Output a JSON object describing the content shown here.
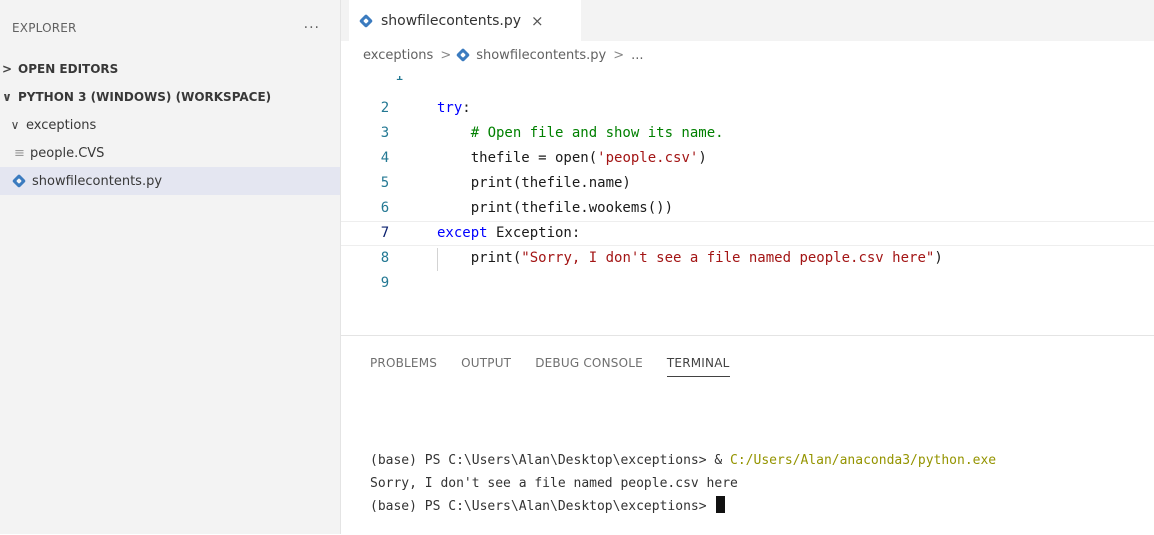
{
  "explorer": {
    "title": "EXPLORER",
    "more": "···",
    "open_editors": "OPEN EDITORS",
    "workspace": "PYTHON 3 (WINDOWS) (WORKSPACE)",
    "folder": "exceptions",
    "files": [
      "people.CVS",
      "showfilecontents.py"
    ],
    "selected_file": "showfilecontents.py"
  },
  "tab": {
    "label": "showfilecontents.py",
    "close": "×"
  },
  "breadcrumb": {
    "folder": "exceptions",
    "file": "showfilecontents.py",
    "more": "..."
  },
  "code": {
    "line_numbers": [
      "2",
      "3",
      "4",
      "5",
      "6",
      "7",
      "8",
      "9"
    ],
    "lines": [
      [
        {
          "t": "kw",
          "v": "try"
        },
        {
          "t": "p",
          "v": ":"
        }
      ],
      [
        {
          "t": "p",
          "v": "    "
        },
        {
          "t": "cm",
          "v": "# Open file and show its name."
        }
      ],
      [
        {
          "t": "p",
          "v": "    thefile = open("
        },
        {
          "t": "st",
          "v": "'people.csv'"
        },
        {
          "t": "p",
          "v": ")"
        }
      ],
      [
        {
          "t": "p",
          "v": "    print(thefile.name)"
        }
      ],
      [
        {
          "t": "p",
          "v": "    print(thefile.wookems())"
        }
      ],
      [
        {
          "t": "kw",
          "v": "except"
        },
        {
          "t": "p",
          "v": " Exception:"
        }
      ],
      [
        {
          "t": "p",
          "v": "    print("
        },
        {
          "t": "st",
          "v": "\"Sorry, I don't see a file named people.csv here\""
        },
        {
          "t": "p",
          "v": ")"
        }
      ],
      []
    ]
  },
  "panel": {
    "tabs": [
      "PROBLEMS",
      "OUTPUT",
      "DEBUG CONSOLE",
      "TERMINAL"
    ],
    "active_tab": "TERMINAL"
  },
  "terminal": {
    "line1_prompt": "(base) PS C:\\Users\\Alan\\Desktop\\exceptions> & ",
    "line1_path": "C:/Users/Alan/anaconda3/python.exe",
    "line2": "Sorry, I don't see a file named people.csv here",
    "line3_prompt": "(base) PS C:\\Users\\Alan\\Desktop\\exceptions> "
  },
  "colors": {
    "keyword": "#0000ff",
    "comment": "#008000",
    "string": "#a31515",
    "line_number": "#237893",
    "terminal_path": "#949400",
    "sidebar_bg": "#f3f3f3",
    "selected_bg": "#e4e6f1"
  }
}
